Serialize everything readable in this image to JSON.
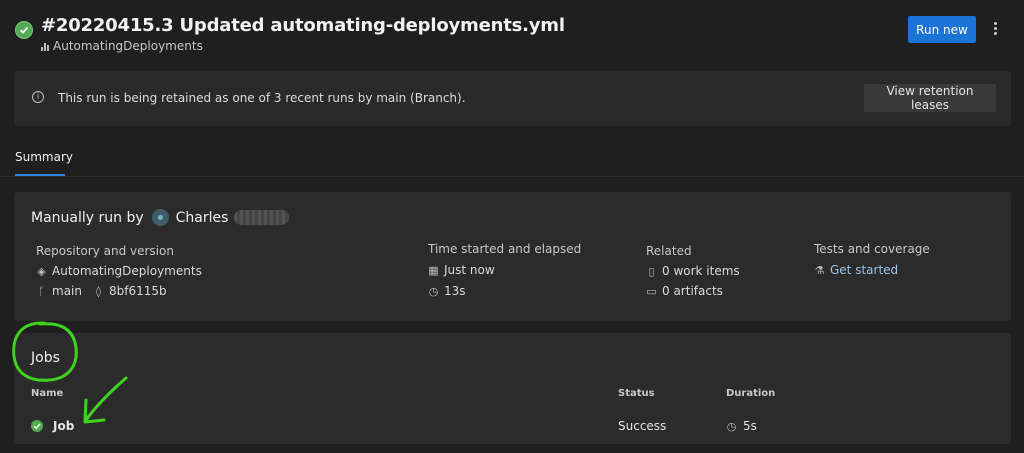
{
  "header": {
    "run_title": "#20220415.3 Updated automating-deployments.yml",
    "repo_name": "AutomatingDeployments",
    "run_new_label": "Run new",
    "status_color": "#54a954"
  },
  "banner": {
    "message": "This run is being retained as one of 3 recent runs by main (Branch).",
    "button_label": "View retention leases"
  },
  "tabs": [
    {
      "label": "Summary",
      "selected": true
    }
  ],
  "summary": {
    "trigger_prefix": "Manually run by",
    "user_first_name": "Charles",
    "columns": {
      "repository": {
        "label": "Repository and version",
        "repo": "AutomatingDeployments",
        "branch": "main",
        "commit": "8bf6115b"
      },
      "time": {
        "label": "Time started and elapsed",
        "started": "Just now",
        "elapsed": "13s"
      },
      "related": {
        "label": "Related",
        "work_items": "0 work items",
        "artifacts": "0 artifacts"
      },
      "tests": {
        "label": "Tests and coverage",
        "link": "Get started"
      }
    }
  },
  "jobs": {
    "title": "Jobs",
    "headers": {
      "name": "Name",
      "status": "Status",
      "duration": "Duration"
    },
    "rows": [
      {
        "name": "Job",
        "status": "Success",
        "duration": "5s"
      }
    ]
  },
  "colors": {
    "accent": "#1b74d6",
    "success": "#54a954",
    "annotation": "#3fd21e"
  }
}
